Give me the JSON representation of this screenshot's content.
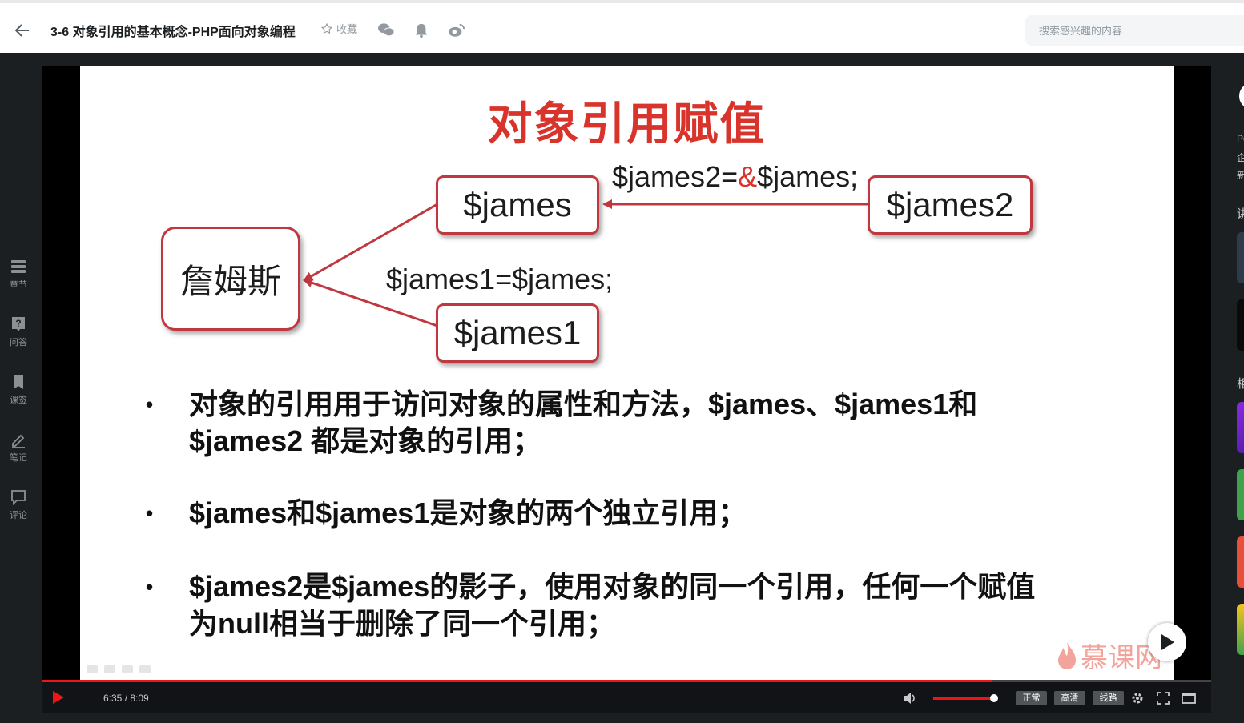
{
  "header": {
    "title": "3-6 对象引用的基本概念-PHP面向对象编程",
    "favorite_label": "收藏",
    "search_placeholder": "搜索感兴趣的内容",
    "share_icons": [
      "wechat-icon",
      "bell-icon",
      "weibo-icon"
    ]
  },
  "sidebar": {
    "items": [
      {
        "label": "章节",
        "icon": "chapter-icon"
      },
      {
        "label": "问答",
        "icon": "question-icon"
      },
      {
        "label": "课签",
        "icon": "bookmark-icon"
      },
      {
        "label": "笔记",
        "icon": "pen-icon"
      },
      {
        "label": "评论",
        "icon": "comment-icon"
      }
    ]
  },
  "slide": {
    "title": "对象引用赋值",
    "object_box": "詹姆斯",
    "ref_james": "$james",
    "ref_james1": "$james1",
    "ref_james2": "$james2",
    "assign_ref_prefix": "$james2=",
    "assign_ref_amp": "&",
    "assign_ref_suffix": "$james;",
    "assign_copy": "$james1=$james;",
    "bullets": [
      "对象的引用用于访问对象的属性和方法，$james、$james1和",
      "$james2 都是对象的引用；",
      "$james和$james1是对象的两个独立引用；",
      "$james2是$james的影子，使用对象的同一个引用，任何一个赋值",
      "为null相当于删除了同一个引用；"
    ],
    "bullet_marker": "•",
    "watermark": "慕课网"
  },
  "player": {
    "time": "6:35 / 8:09",
    "progress": 0.813,
    "volume": 0.95,
    "quality_buttons": [
      "正常",
      "高清",
      "线路"
    ],
    "accent_color": "#f01414"
  },
  "rightpanel": {
    "texts": [
      "Pe",
      "企",
      "新",
      "讲",
      "相"
    ]
  }
}
